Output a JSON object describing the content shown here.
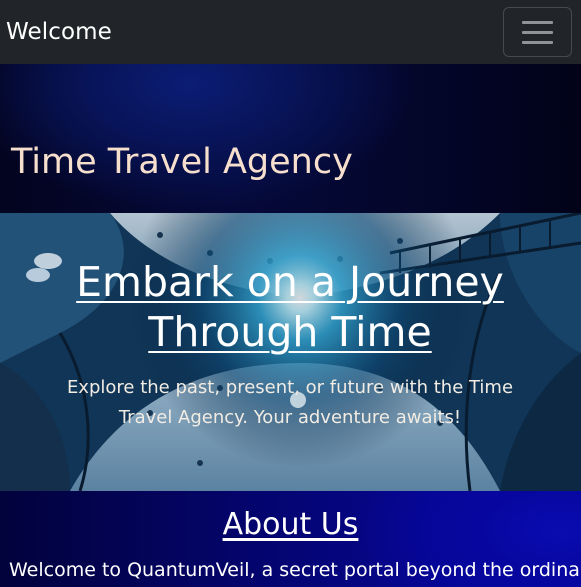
{
  "navbar": {
    "brand": "Welcome",
    "toggler_icon": "hamburger-menu-icon"
  },
  "header": {
    "title": "Time Travel Agency"
  },
  "hero": {
    "title": "Embark on a Journey Through Time",
    "text": "Explore the past, present, or future with the Time Travel Agency. Your adventure awaits!"
  },
  "about": {
    "title": "About Us",
    "text": "Welcome to QuantumVeil, a secret portal beyond the ordinary"
  },
  "colors": {
    "navbar_bg": "#212529",
    "title_text": "#f7dfcd",
    "about_accent": "#0808a8"
  }
}
